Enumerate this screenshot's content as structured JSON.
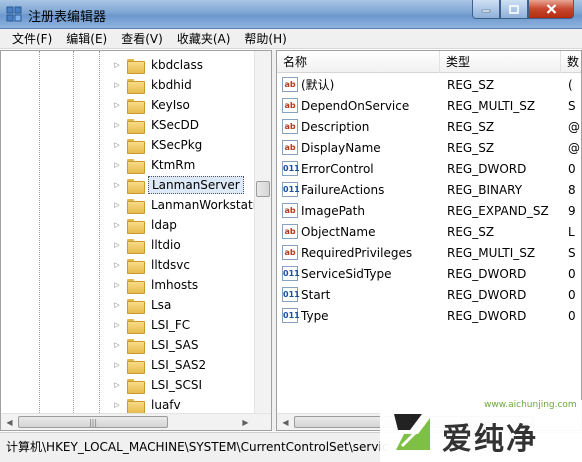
{
  "window": {
    "title": "注册表编辑器",
    "icon": "registry-editor-icon",
    "controls": {
      "minimize": "minimize-icon",
      "maximize": "maximize-icon",
      "close": "close-icon"
    }
  },
  "menu": [
    "文件(F)",
    "编辑(E)",
    "查看(V)",
    "收藏夹(A)",
    "帮助(H)"
  ],
  "tree": {
    "items": [
      {
        "label": "kbdclass",
        "selected": false
      },
      {
        "label": "kbdhid",
        "selected": false
      },
      {
        "label": "KeyIso",
        "selected": false
      },
      {
        "label": "KSecDD",
        "selected": false
      },
      {
        "label": "KSecPkg",
        "selected": false
      },
      {
        "label": "KtmRm",
        "selected": false
      },
      {
        "label": "LanmanServer",
        "selected": true
      },
      {
        "label": "LanmanWorkstatio",
        "selected": false
      },
      {
        "label": "ldap",
        "selected": false
      },
      {
        "label": "lltdio",
        "selected": false
      },
      {
        "label": "lltdsvc",
        "selected": false
      },
      {
        "label": "lmhosts",
        "selected": false
      },
      {
        "label": "Lsa",
        "selected": false
      },
      {
        "label": "LSI_FC",
        "selected": false
      },
      {
        "label": "LSI_SAS",
        "selected": false
      },
      {
        "label": "LSI_SAS2",
        "selected": false
      },
      {
        "label": "LSI_SCSI",
        "selected": false
      },
      {
        "label": "luafv",
        "selected": false
      }
    ],
    "hscroll_grip": "|||"
  },
  "list": {
    "columns": [
      "名称",
      "类型",
      "数"
    ],
    "rows": [
      {
        "name": "(默认)",
        "type": "REG_SZ",
        "data": "(",
        "icon": "string-value-icon"
      },
      {
        "name": "DependOnService",
        "type": "REG_MULTI_SZ",
        "data": "S",
        "icon": "string-value-icon"
      },
      {
        "name": "Description",
        "type": "REG_SZ",
        "data": "@",
        "icon": "string-value-icon"
      },
      {
        "name": "DisplayName",
        "type": "REG_SZ",
        "data": "@",
        "icon": "string-value-icon"
      },
      {
        "name": "ErrorControl",
        "type": "REG_DWORD",
        "data": "0",
        "icon": "binary-value-icon"
      },
      {
        "name": "FailureActions",
        "type": "REG_BINARY",
        "data": "8",
        "icon": "binary-value-icon"
      },
      {
        "name": "ImagePath",
        "type": "REG_EXPAND_SZ",
        "data": "9",
        "icon": "string-value-icon"
      },
      {
        "name": "ObjectName",
        "type": "REG_SZ",
        "data": "L",
        "icon": "string-value-icon"
      },
      {
        "name": "RequiredPrivileges",
        "type": "REG_MULTI_SZ",
        "data": "S",
        "icon": "string-value-icon"
      },
      {
        "name": "ServiceSidType",
        "type": "REG_DWORD",
        "data": "0",
        "icon": "binary-value-icon"
      },
      {
        "name": "Start",
        "type": "REG_DWORD",
        "data": "0",
        "icon": "binary-value-icon"
      },
      {
        "name": "Type",
        "type": "REG_DWORD",
        "data": "0",
        "icon": "binary-value-icon"
      }
    ]
  },
  "status": "计算机\\HKEY_LOCAL_MACHINE\\SYSTEM\\CurrentControlSet\\servic",
  "watermark": {
    "brand": "爱纯净",
    "url": "www.aichunjing.com"
  }
}
